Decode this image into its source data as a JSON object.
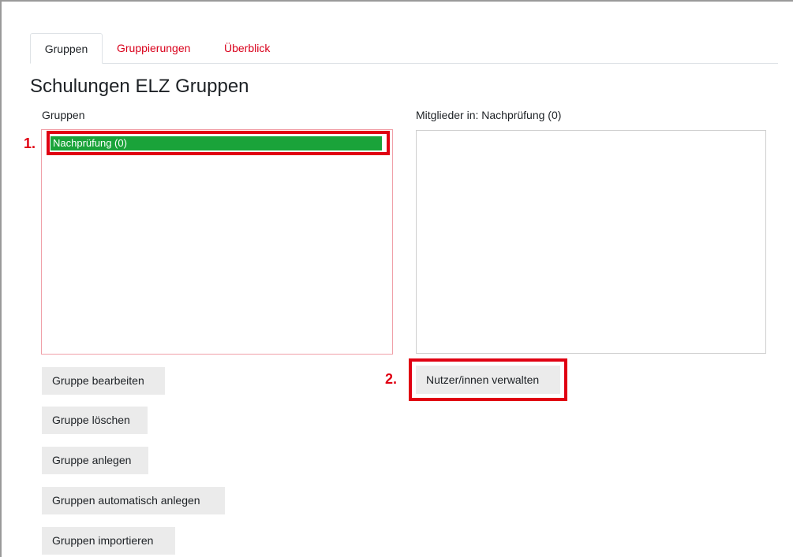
{
  "tabs": [
    {
      "label": "Gruppen",
      "active": true
    },
    {
      "label": "Gruppierungen",
      "active": false
    },
    {
      "label": "Überblick",
      "active": false
    }
  ],
  "page_title": "Schulungen ELZ Gruppen",
  "groups_panel": {
    "label": "Gruppen",
    "options": [
      {
        "label": "Nachprüfung (0)",
        "selected": true
      }
    ]
  },
  "members_panel": {
    "label": "Mitglieder in: Nachprüfung (0)",
    "options": []
  },
  "buttons": {
    "edit_group": "Gruppe bearbeiten",
    "delete_group": "Gruppe löschen",
    "create_group": "Gruppe anlegen",
    "auto_create": "Gruppen automatisch anlegen",
    "import_groups": "Gruppen importieren",
    "manage_users": "Nutzer/innen verwalten"
  },
  "annotations": {
    "step1": "1.",
    "step2": "2."
  },
  "colors": {
    "accent_link": "#d9001b",
    "selected_option": "#1aa33a",
    "annotation": "#e00012",
    "button_bg": "#ebebeb"
  }
}
